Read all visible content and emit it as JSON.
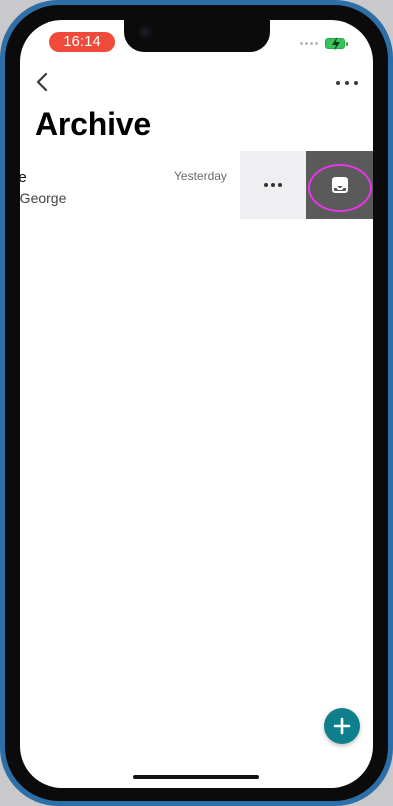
{
  "status_bar": {
    "time": "16:14",
    "time_pill_color": "#f04a3a",
    "battery_color": "#37c45d"
  },
  "header": {
    "title": "Archive",
    "back_icon": "chevron-left-icon",
    "more_icon": "ellipsis-icon"
  },
  "archive_list": {
    "items": [
      {
        "title": "ne",
        "subtitle": "o George",
        "date": "Yesterday"
      }
    ]
  },
  "swipe_actions": {
    "more_icon": "ellipsis-icon",
    "unarchive_icon": "inbox-icon",
    "unarchive_color": "#5a5a5a",
    "more_color": "#efeff1"
  },
  "fab": {
    "icon": "plus-icon",
    "color": "#0f7f8c"
  },
  "highlight_color": "#e636e6"
}
